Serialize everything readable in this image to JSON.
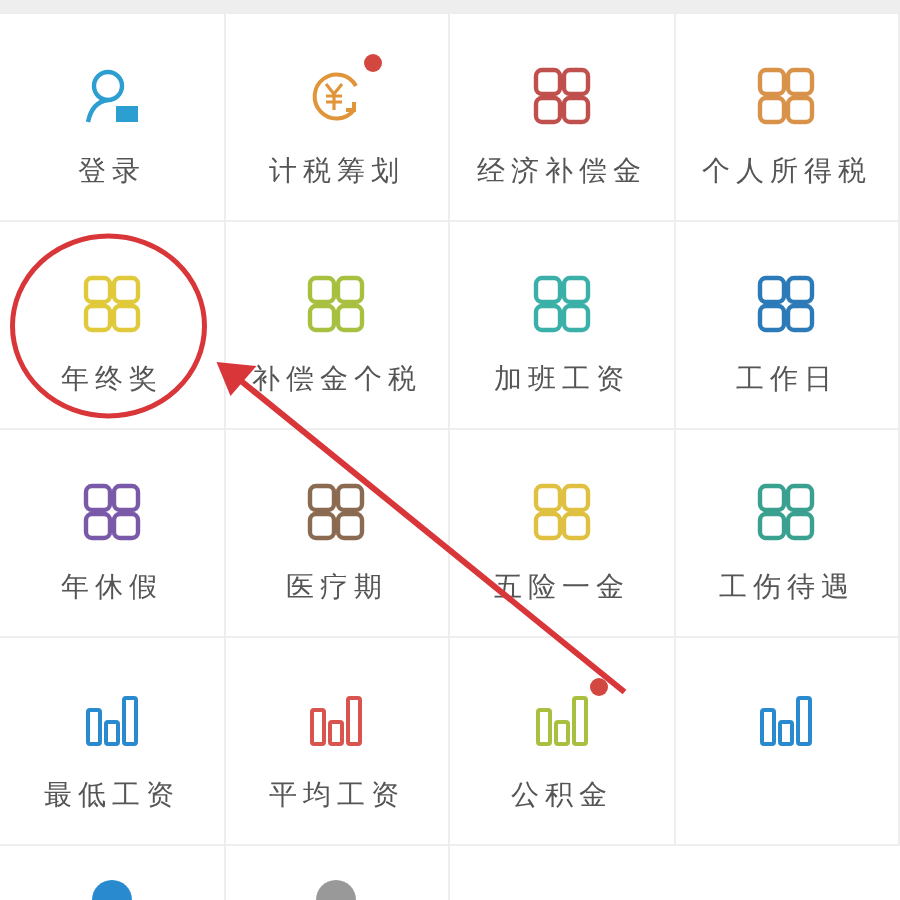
{
  "grid": [
    {
      "label": "登录",
      "kind": "person",
      "color": "#2c9ed0",
      "badge": false,
      "highlighted": false
    },
    {
      "label": "计税筹划",
      "kind": "yen",
      "color": "#e0953a",
      "badge": true,
      "highlighted": false
    },
    {
      "label": "经济补偿金",
      "kind": "grid",
      "color": "#c0504d",
      "badge": false,
      "highlighted": false
    },
    {
      "label": "个人所得税",
      "kind": "grid",
      "color": "#d9924a",
      "badge": false,
      "highlighted": false
    },
    {
      "label": "年终奖",
      "kind": "grid",
      "color": "#e0c93a",
      "badge": false,
      "highlighted": true
    },
    {
      "label": "补偿金个税",
      "kind": "grid",
      "color": "#a8c040",
      "badge": false,
      "highlighted": false
    },
    {
      "label": "加班工资",
      "kind": "grid",
      "color": "#3ab0a8",
      "badge": false,
      "highlighted": false
    },
    {
      "label": "工作日",
      "kind": "grid",
      "color": "#2c7ab8",
      "badge": false,
      "highlighted": false
    },
    {
      "label": "年休假",
      "kind": "grid",
      "color": "#7a5aa8",
      "badge": false,
      "highlighted": false
    },
    {
      "label": "医疗期",
      "kind": "grid",
      "color": "#8a6a50",
      "badge": false,
      "highlighted": false
    },
    {
      "label": "五险一金",
      "kind": "grid",
      "color": "#e0c040",
      "badge": false,
      "highlighted": false
    },
    {
      "label": "工伤待遇",
      "kind": "grid",
      "color": "#3aa090",
      "badge": false,
      "highlighted": false
    },
    {
      "label": "最低工资",
      "kind": "bars",
      "color": "#2a8ad0",
      "badge": false,
      "highlighted": false
    },
    {
      "label": "平均工资",
      "kind": "bars",
      "color": "#d9534f",
      "badge": false,
      "highlighted": false
    },
    {
      "label": "公积金",
      "kind": "bars",
      "color": "#a8c040",
      "badge": true,
      "highlighted": false
    },
    {
      "kind": "bars",
      "color": "#2a8ad0",
      "badge": false,
      "highlighted": false
    },
    {
      "kind": "dot",
      "color": "#2a8ad0",
      "badge": false,
      "highlighted": false
    },
    {
      "kind": "dot",
      "color": "#999999",
      "badge": false,
      "highlighted": false
    }
  ]
}
